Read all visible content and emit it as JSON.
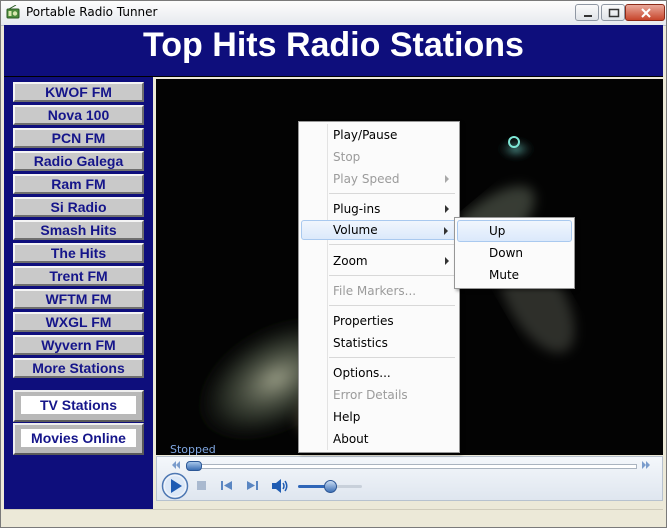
{
  "window": {
    "title": "Portable Radio Tunner"
  },
  "header": {
    "title": "Top Hits Radio Stations"
  },
  "sidebar": {
    "stations": [
      "KWOF FM",
      "Nova 100",
      "PCN FM",
      "Radio Galega",
      "Ram FM",
      "Si Radio",
      "Smash Hits",
      "The Hits",
      "Trent FM",
      "WFTM FM",
      "WXGL FM",
      "Wyvern FM",
      "More Stations"
    ],
    "tv_label": "TV Stations",
    "movies_label": "Movies Online"
  },
  "player": {
    "status": "Stopped",
    "seek_position": 0.0,
    "volume_level": 0.5
  },
  "context_menu": {
    "play_pause": "Play/Pause",
    "stop": "Stop",
    "play_speed": "Play Speed",
    "plugins": "Plug-ins",
    "volume": "Volume",
    "zoom": "Zoom",
    "file_markers": "File Markers...",
    "properties": "Properties",
    "statistics": "Statistics",
    "options": "Options...",
    "error_details": "Error Details",
    "help": "Help",
    "about": "About"
  },
  "volume_submenu": {
    "up": "Up",
    "down": "Down",
    "mute": "Mute"
  },
  "colors": {
    "header_bg": "#0e0e7c",
    "sidebar_bg": "#0e0e7c",
    "station_text": "#15158a",
    "accent": "#2f66b8"
  }
}
